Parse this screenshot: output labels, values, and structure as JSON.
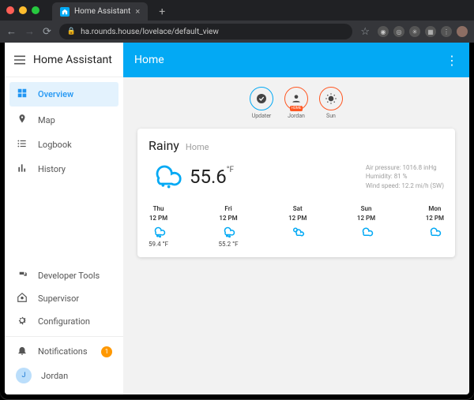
{
  "browser": {
    "tab_title": "Home Assistant",
    "url": "ha.rounds.house/lovelace/default_view"
  },
  "sidebar": {
    "title": "Home Assistant",
    "items": [
      {
        "label": "Overview"
      },
      {
        "label": "Map"
      },
      {
        "label": "Logbook"
      },
      {
        "label": "History"
      }
    ],
    "bottom": [
      {
        "label": "Developer Tools"
      },
      {
        "label": "Supervisor"
      },
      {
        "label": "Configuration"
      },
      {
        "label": "Notifications",
        "badge": "1"
      },
      {
        "label": "Jordan",
        "initial": "J"
      }
    ]
  },
  "header": {
    "title": "Home"
  },
  "chips": [
    {
      "label": "Updater",
      "icon": "check-shield"
    },
    {
      "label": "Jordan",
      "icon": "person",
      "badge": "HOME"
    },
    {
      "label": "Sun",
      "icon": "sun"
    }
  ],
  "weather": {
    "condition": "Rainy",
    "location": "Home",
    "temp": "55.6",
    "unit": "°F",
    "attrs": [
      "Air pressure: 1016.8 inHg",
      "Humidity: 81 %",
      "Wind speed: 12.2 mi/h (SW)"
    ],
    "forecast": [
      {
        "day": "Thu",
        "time": "12 PM",
        "icon": "rainy",
        "temp": "59.4 °F"
      },
      {
        "day": "Fri",
        "time": "12 PM",
        "icon": "rainy",
        "temp": "55.2 °F"
      },
      {
        "day": "Sat",
        "time": "12 PM",
        "icon": "partly",
        "temp": ""
      },
      {
        "day": "Sun",
        "time": "12 PM",
        "icon": "cloudy",
        "temp": ""
      },
      {
        "day": "Mon",
        "time": "12 PM",
        "icon": "cloudy",
        "temp": ""
      }
    ]
  }
}
